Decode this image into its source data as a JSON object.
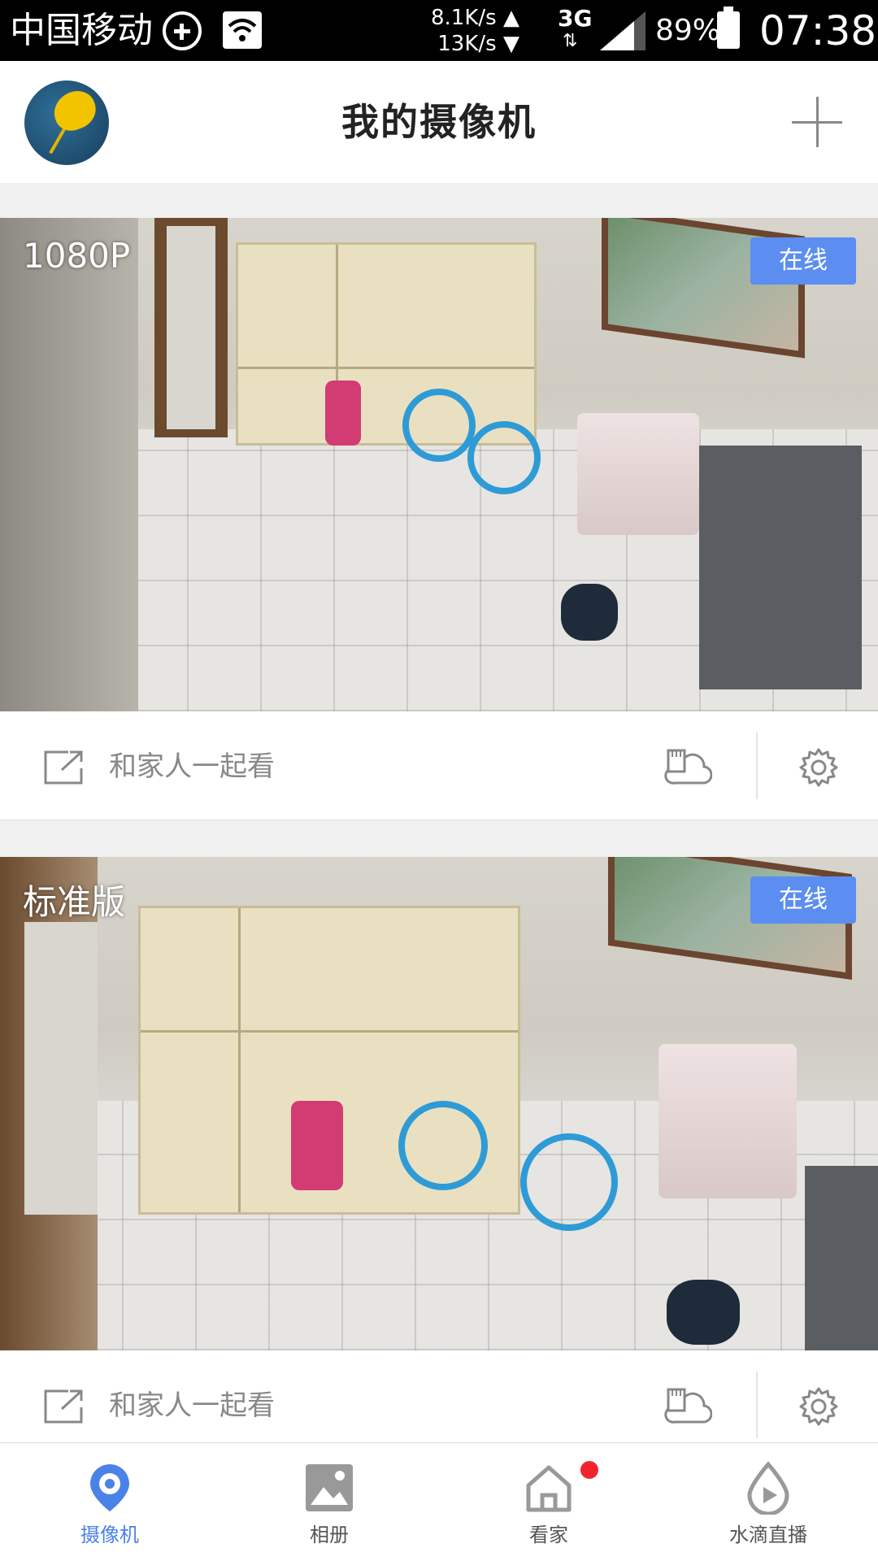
{
  "status_bar": {
    "carrier": "中国移动",
    "speed_up": "8.1K/s ▲",
    "speed_down": "13K/s ▼",
    "network": "3G",
    "battery": "89%",
    "time": "07:38"
  },
  "header": {
    "title": "我的摄像机"
  },
  "cameras": [
    {
      "resolution": "1080P",
      "status": "在线",
      "share_label": "和家人一起看"
    },
    {
      "resolution": "标准版",
      "status": "在线",
      "share_label": "和家人一起看"
    }
  ],
  "tabs": [
    {
      "label": "摄像机",
      "icon": "camera-pin-icon",
      "active": true
    },
    {
      "label": "相册",
      "icon": "album-icon",
      "active": false
    },
    {
      "label": "看家",
      "icon": "home-icon",
      "active": false
    },
    {
      "label": "水滴直播",
      "icon": "waterdrop-play-icon",
      "active": false
    }
  ],
  "colors": {
    "accent": "#4b82e8",
    "online_badge": "#5b8ef0",
    "notification_dot": "#f2242b"
  }
}
